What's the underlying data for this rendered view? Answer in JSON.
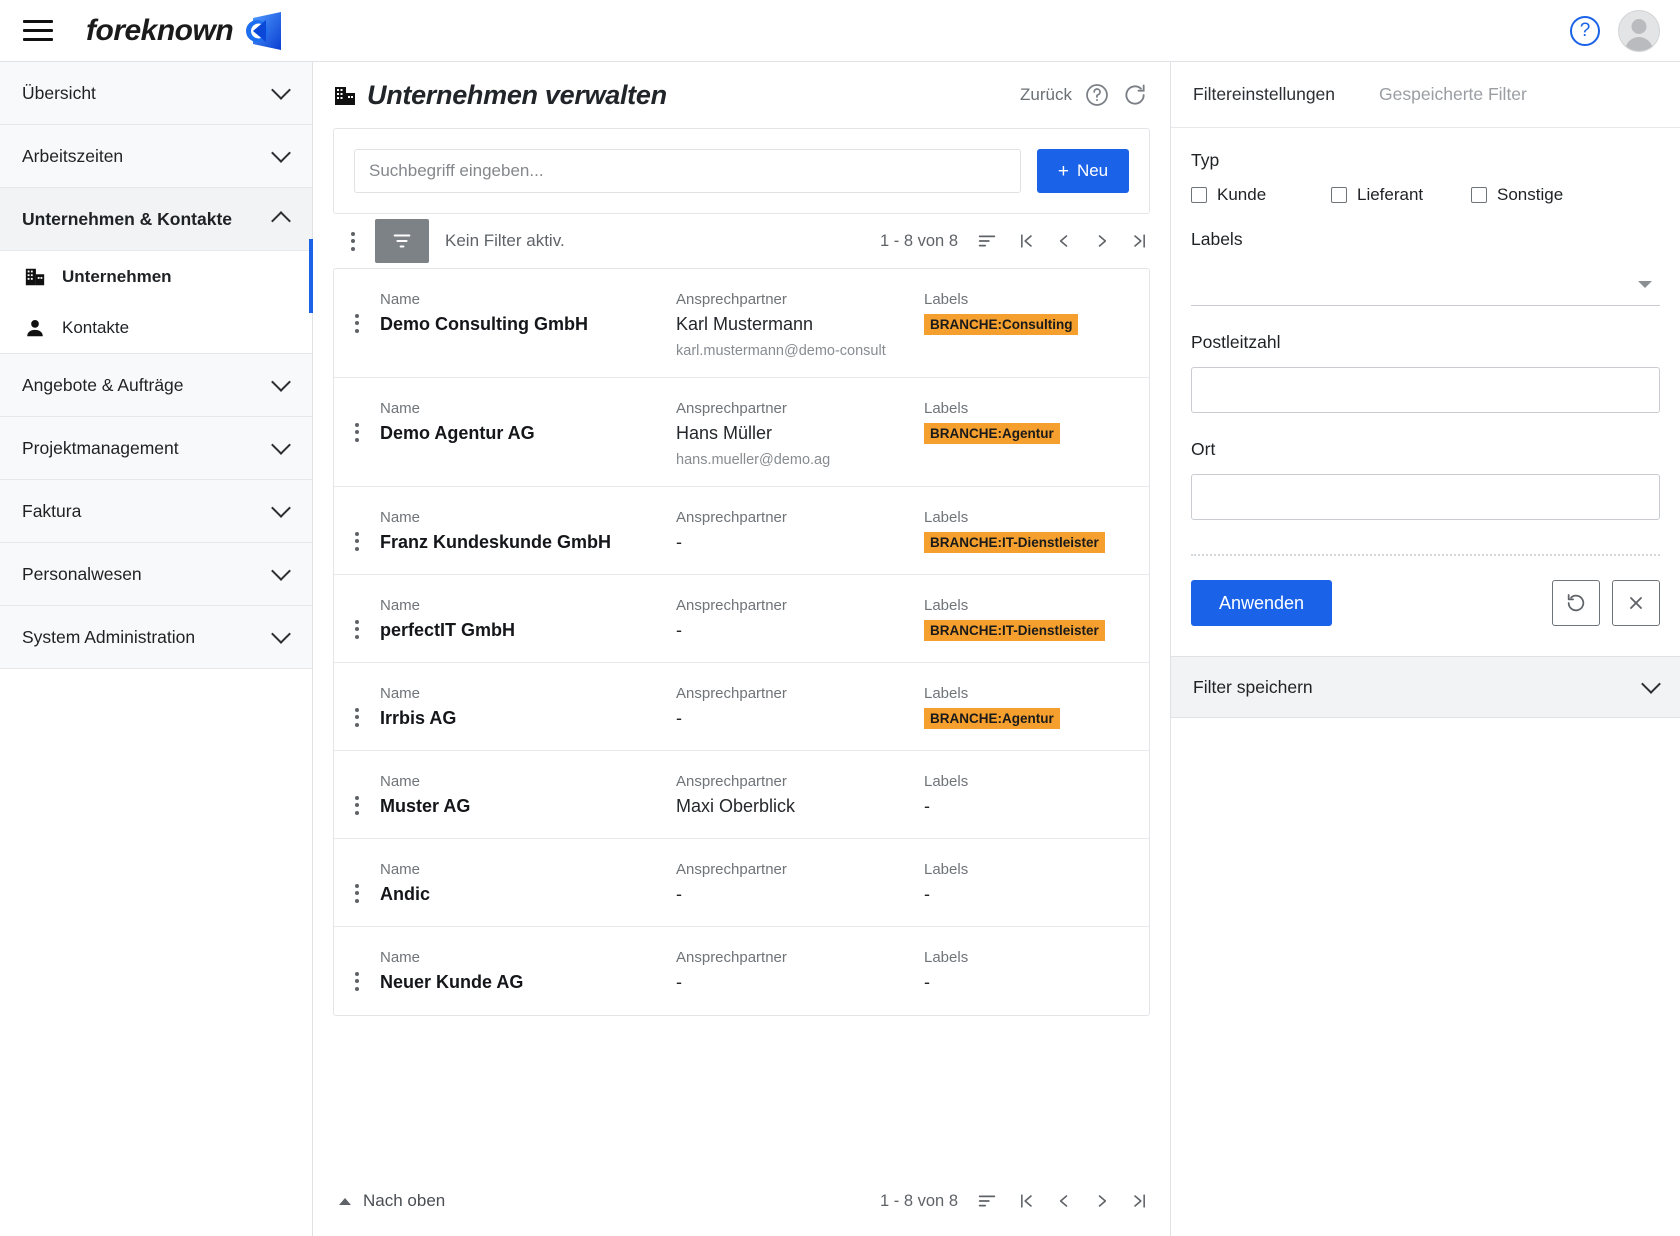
{
  "topbar": {
    "menu_icon": "hamburger-icon",
    "brand_text": "foreknown",
    "brand_mark_icon": "foreknown-logo-icon",
    "help_icon": "help-circle-icon",
    "help_glyph": "?",
    "avatar_icon": "user-avatar-icon"
  },
  "sidebar": {
    "groups": [
      {
        "label": "Übersicht",
        "expanded": false
      },
      {
        "label": "Arbeitszeiten",
        "expanded": false
      },
      {
        "label": "Unternehmen & Kontakte",
        "expanded": true
      },
      {
        "label": "Angebote & Aufträge",
        "expanded": false
      },
      {
        "label": "Projektmanagement",
        "expanded": false
      },
      {
        "label": "Faktura",
        "expanded": false
      },
      {
        "label": "Personalwesen",
        "expanded": false
      },
      {
        "label": "System Administration",
        "expanded": false
      }
    ],
    "sub_items": [
      {
        "label": "Unternehmen",
        "icon": "building-icon",
        "active": true
      },
      {
        "label": "Kontakte",
        "icon": "person-icon",
        "active": false
      }
    ]
  },
  "main": {
    "title": "Unternehmen verwalten",
    "title_icon": "building-icon",
    "back_label": "Zurück",
    "help_icon": "help-circle-icon",
    "refresh_icon": "refresh-icon",
    "search": {
      "placeholder": "Suchbegriff eingeben...",
      "value": ""
    },
    "new_button": {
      "label": "Neu",
      "icon": "plus-icon"
    },
    "toolbar": {
      "kebab_icon": "more-vertical-icon",
      "filter_icon": "filter-icon",
      "filter_status": "Kein Filter aktiv.",
      "pagination_text": "1 - 8 von 8",
      "sort_icon": "sort-icon",
      "first_icon": "first-page-icon",
      "prev_icon": "prev-page-icon",
      "next_icon": "next-page-icon",
      "last_icon": "last-page-icon"
    },
    "columns": {
      "name": "Name",
      "contact": "Ansprechpartner",
      "labels": "Labels"
    },
    "rows": [
      {
        "name": "Demo Consulting GmbH",
        "contact": "Karl Mustermann",
        "email": "karl.mustermann@demo-consult",
        "label": "BRANCHE:Consulting"
      },
      {
        "name": "Demo Agentur AG",
        "contact": "Hans Müller",
        "email": "hans.mueller@demo.ag",
        "label": "BRANCHE:Agentur"
      },
      {
        "name": "Franz Kundeskunde GmbH",
        "contact": "-",
        "email": "",
        "label": "BRANCHE:IT-Dienstleister"
      },
      {
        "name": "perfectIT GmbH",
        "contact": "-",
        "email": "",
        "label": "BRANCHE:IT-Dienstleister"
      },
      {
        "name": "Irrbis AG",
        "contact": "-",
        "email": "",
        "label": "BRANCHE:Agentur"
      },
      {
        "name": "Muster AG",
        "contact": "Maxi Oberblick",
        "email": "",
        "label": "-"
      },
      {
        "name": "Andic",
        "contact": "-",
        "email": "",
        "label": "-"
      },
      {
        "name": "Neuer Kunde AG",
        "contact": "-",
        "email": "",
        "label": "-"
      }
    ],
    "footer": {
      "top_label": "Nach oben",
      "top_icon": "caret-up-icon",
      "pagination_text": "1 - 8 von 8"
    }
  },
  "filterpanel": {
    "tab_active": "Filtereinstellungen",
    "tab_inactive": "Gespeicherte Filter",
    "typ_label": "Typ",
    "typ_options": [
      {
        "label": "Kunde",
        "checked": false
      },
      {
        "label": "Lieferant",
        "checked": false
      },
      {
        "label": "Sonstige",
        "checked": false
      }
    ],
    "labels_label": "Labels",
    "labels_value": "",
    "plz_label": "Postleitzahl",
    "plz_value": "",
    "ort_label": "Ort",
    "ort_value": "",
    "apply_label": "Anwenden",
    "reset_icon": "undo-icon",
    "clear_icon": "close-icon",
    "save_label": "Filter speichern",
    "save_chevron_icon": "chevron-down-icon"
  },
  "colors": {
    "accent": "#1a63e8",
    "badge": "#f5a02e",
    "panel_bg": "#f8f9fa",
    "border": "#dfe1e5"
  }
}
